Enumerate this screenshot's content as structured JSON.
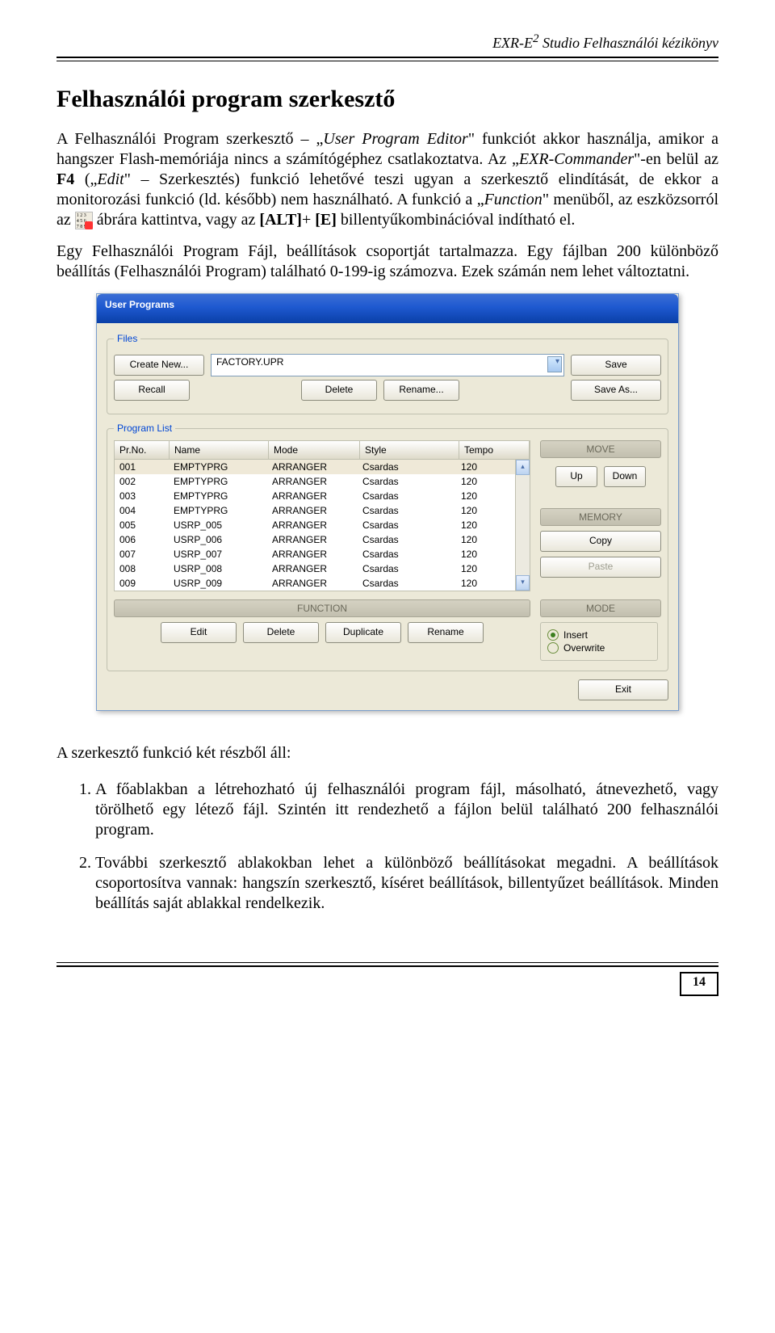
{
  "header": {
    "doc_title_prefix": "EXR-E",
    "doc_title_sup": "2",
    "doc_title_suffix": " Studio Felhasználói kézikönyv"
  },
  "section_title": "Felhasználói program szerkesztő",
  "paragraphs": {
    "p1_a": "A Felhasználói Program szerkesztő – „",
    "p1_i1": "User Program Editor",
    "p1_b": "\" funkciót akkor használja, amikor a hangszer Flash-memóriája nincs a számítógéphez csatlakoztatva. Az „",
    "p1_i2": "EXR-Commander",
    "p1_c": "\"-en belül az ",
    "p1_bold1": "F4",
    "p1_d": " („",
    "p1_i3": "Edit",
    "p1_e": "\" – Szerkesztés) funkció lehetővé teszi ugyan a szerkesztő elindítását, de ekkor a monitorozási funkció (ld. később) nem használható. A funkció a „",
    "p1_i4": "Function",
    "p1_f": "\" menüből, az eszközsorról az ",
    "p1_g": " ábrára kattintva, vagy az ",
    "p1_bold2": "[ALT]",
    "p1_h": "+ ",
    "p1_bold3": "[E]",
    "p1_i": " billentyűkombinációval indítható el.",
    "p2": "Egy Felhasználói Program Fájl, beállítások csoportját tartalmazza. Egy fájlban 200 különböző beállítás (Felhasználói Program) található 0-199-ig számozva. Ezek számán nem lehet változtatni."
  },
  "dialog": {
    "title": "User Programs",
    "files": {
      "legend": "Files",
      "create_new": "Create New...",
      "file_selected": "FACTORY.UPR",
      "save": "Save",
      "recall": "Recall",
      "delete": "Delete",
      "rename": "Rename...",
      "save_as": "Save As..."
    },
    "proglist": {
      "legend": "Program List",
      "headers": {
        "prno": "Pr.No.",
        "name": "Name",
        "mode": "Mode",
        "style": "Style",
        "tempo": "Tempo"
      },
      "rows": [
        {
          "prno": "001",
          "name": "EMPTYPRG",
          "mode": "ARRANGER",
          "style": "Csardas",
          "tempo": "120"
        },
        {
          "prno": "002",
          "name": "EMPTYPRG",
          "mode": "ARRANGER",
          "style": "Csardas",
          "tempo": "120"
        },
        {
          "prno": "003",
          "name": "EMPTYPRG",
          "mode": "ARRANGER",
          "style": "Csardas",
          "tempo": "120"
        },
        {
          "prno": "004",
          "name": "EMPTYPRG",
          "mode": "ARRANGER",
          "style": "Csardas",
          "tempo": "120"
        },
        {
          "prno": "005",
          "name": "USRP_005",
          "mode": "ARRANGER",
          "style": "Csardas",
          "tempo": "120"
        },
        {
          "prno": "006",
          "name": "USRP_006",
          "mode": "ARRANGER",
          "style": "Csardas",
          "tempo": "120"
        },
        {
          "prno": "007",
          "name": "USRP_007",
          "mode": "ARRANGER",
          "style": "Csardas",
          "tempo": "120"
        },
        {
          "prno": "008",
          "name": "USRP_008",
          "mode": "ARRANGER",
          "style": "Csardas",
          "tempo": "120"
        },
        {
          "prno": "009",
          "name": "USRP_009",
          "mode": "ARRANGER",
          "style": "Csardas",
          "tempo": "120"
        }
      ],
      "move_head": "MOVE",
      "up": "Up",
      "down": "Down",
      "memory_head": "MEMORY",
      "copy": "Copy",
      "paste": "Paste",
      "function_head": "FUNCTION",
      "mode_head": "MODE",
      "edit": "Edit",
      "fn_delete": "Delete",
      "duplicate": "Duplicate",
      "fn_rename": "Rename",
      "insert": "Insert",
      "overwrite": "Overwrite"
    },
    "exit": "Exit"
  },
  "after_para": "A szerkesztő funkció két részből áll:",
  "list": {
    "item1": "A főablakban a létrehozható új felhasználói program fájl, másolható, átnevezhető, vagy törölhető egy létező fájl. Szintén itt rendezhető a fájlon belül található 200 felhasználói program.",
    "item2": "További szerkesztő ablakokban lehet a különböző beállításokat megadni. A beállítások csoportosítva vannak: hangszín szerkesztő, kíséret beállítások, billentyűzet beállítások. Minden beállítás saját ablakkal rendelkezik."
  },
  "pagenum": "14"
}
